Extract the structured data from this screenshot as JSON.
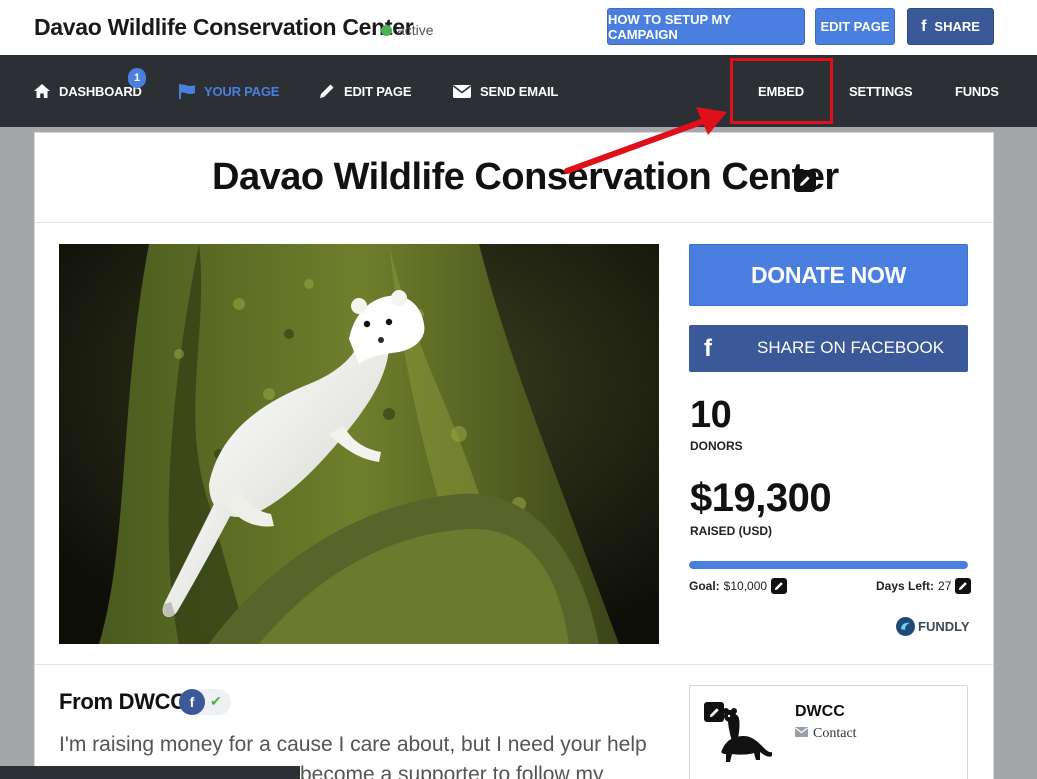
{
  "header": {
    "title": "Davao Wildlife Conservation Center",
    "status": "active",
    "buttons": {
      "setup": "HOW TO SETUP MY CAMPAIGN",
      "edit_page": "EDIT PAGE",
      "share": "SHARE"
    }
  },
  "nav": {
    "items": [
      {
        "label": "DASHBOARD",
        "icon": "home-icon",
        "badge": "1"
      },
      {
        "label": "YOUR PAGE",
        "icon": "flag-icon",
        "active": true
      },
      {
        "label": "EDIT PAGE",
        "icon": "pencil-icon"
      },
      {
        "label": "SEND EMAIL",
        "icon": "envelope-icon"
      },
      {
        "label": "EMBED"
      },
      {
        "label": "SETTINGS"
      },
      {
        "label": "FUNDS"
      }
    ],
    "highlighted": "EMBED",
    "annotation_color": "#e0101a"
  },
  "campaign": {
    "title": "Davao Wildlife Conservation Center",
    "photo": "white ermine on mossy tree trunk",
    "donate_label": "DONATE NOW",
    "facebook_label": "SHARE ON FACEBOOK",
    "donors_count": "10",
    "donors_label": "DONORS",
    "raised_amount": "$19,300",
    "raised_label": "RAISED (USD)",
    "progress_fraction": 1.0,
    "goal_label": "Goal:",
    "goal_value": "$10,000",
    "days_left_label": "Days Left:",
    "days_left_value": "27",
    "brand": "FUNDLY"
  },
  "story": {
    "from_title": "From DWCC",
    "text_line1": "I'm raising money for a cause I care about, but I need your help",
    "text_line2": "become a supporter to follow my"
  },
  "owner": {
    "name": "DWCC",
    "contact_label": "Contact"
  },
  "colors": {
    "primary": "#4a7fe0",
    "facebook": "#3b5898",
    "nav_bg": "#2c2f33",
    "status_green": "#4caf50"
  }
}
